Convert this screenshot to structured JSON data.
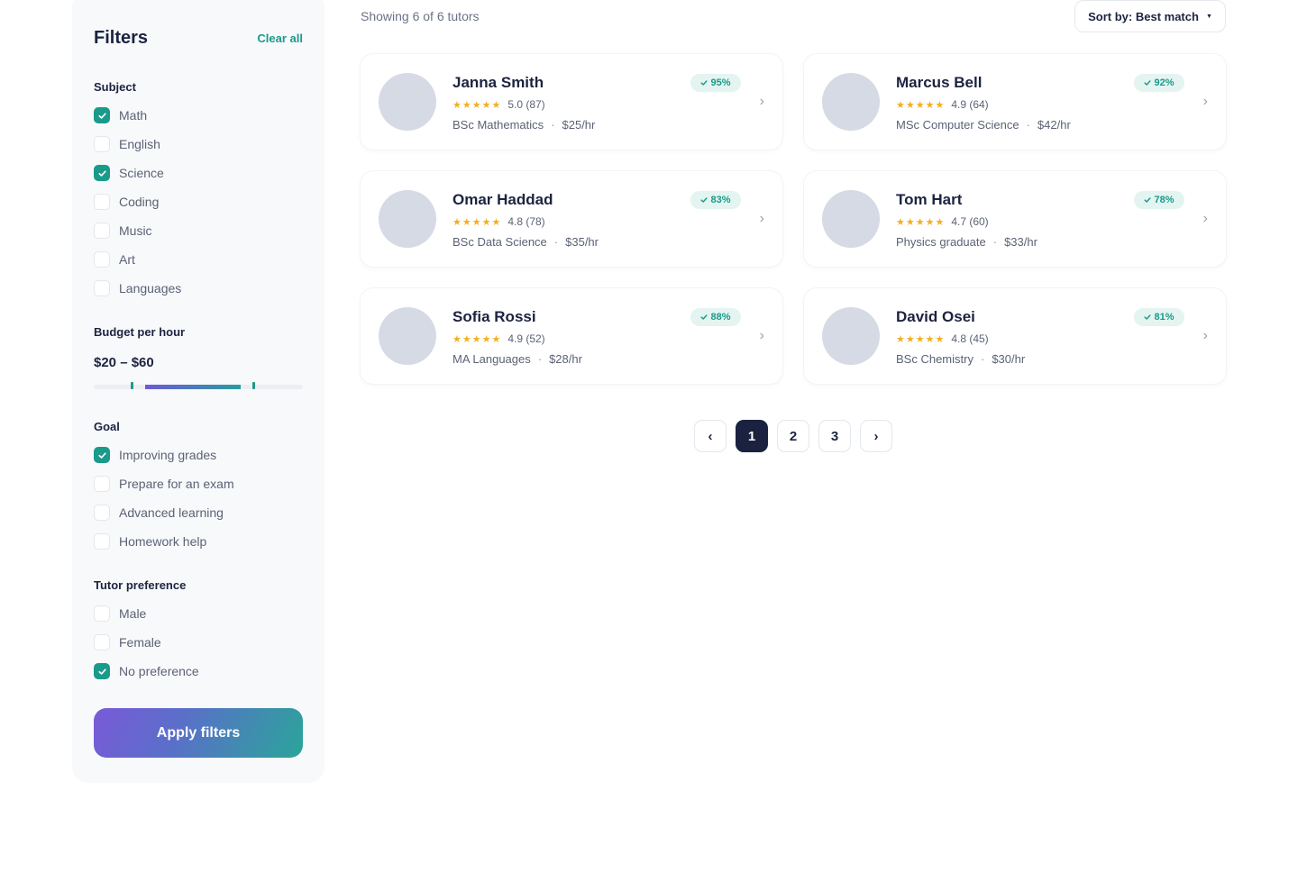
{
  "filters": {
    "title": "Filters",
    "clear_all": "Clear all",
    "subject": {
      "title": "Subject",
      "options": [
        {
          "label": "Math",
          "checked": true
        },
        {
          "label": "English",
          "checked": false
        },
        {
          "label": "Science",
          "checked": true
        },
        {
          "label": "Coding",
          "checked": false
        },
        {
          "label": "Music",
          "checked": false
        },
        {
          "label": "Art",
          "checked": false
        },
        {
          "label": "Languages",
          "checked": false
        }
      ]
    },
    "budget": {
      "title": "Budget per hour",
      "value": "$20 – $60",
      "min": 20,
      "max": 60
    },
    "goal": {
      "title": "Goal",
      "options": [
        {
          "label": "Improving grades",
          "checked": true
        },
        {
          "label": "Prepare for an exam",
          "checked": false
        },
        {
          "label": "Advanced learning",
          "checked": false
        },
        {
          "label": "Homework help",
          "checked": false
        }
      ]
    },
    "preference": {
      "title": "Tutor preference",
      "options": [
        {
          "label": "Male",
          "checked": false
        },
        {
          "label": "Female",
          "checked": false
        },
        {
          "label": "No preference",
          "checked": true
        }
      ]
    },
    "apply_label": "Apply filters"
  },
  "results": {
    "count_text": "Showing 6 of 6 tutors",
    "sort_label": "Sort by: Best match"
  },
  "tutors": [
    {
      "name": "Janna Smith",
      "stars": "★★★★★",
      "rating": "5.0 (87)",
      "degree": "BSc Mathematics",
      "rate": "$25/hr",
      "match": "95%"
    },
    {
      "name": "Marcus Bell",
      "stars": "★★★★★",
      "rating": "4.9 (64)",
      "degree": "MSc Computer Science",
      "rate": "$42/hr",
      "match": "92%"
    },
    {
      "name": "Omar Haddad",
      "stars": "★★★★★",
      "rating": "4.8 (78)",
      "degree": "BSc Data Science",
      "rate": "$35/hr",
      "match": "83%"
    },
    {
      "name": "Tom Hart",
      "stars": "★★★★★",
      "rating": "4.7 (60)",
      "degree": "Physics graduate",
      "rate": "$33/hr",
      "match": "78%"
    },
    {
      "name": "Sofia Rossi",
      "stars": "★★★★★",
      "rating": "4.9 (52)",
      "degree": "MA Languages",
      "rate": "$28/hr",
      "match": "88%"
    },
    {
      "name": "David Osei",
      "stars": "★★★★★",
      "rating": "4.8 (45)",
      "degree": "BSc Chemistry",
      "rate": "$30/hr",
      "match": "81%"
    }
  ],
  "icons": {
    "check": "check-icon",
    "chevron_right": "›",
    "chevron_left": "‹",
    "caret_down": "▼"
  },
  "pagination": {
    "prev": "‹",
    "pages": [
      "1",
      "2",
      "3"
    ],
    "current": "1",
    "next": "›"
  },
  "colors": {
    "accent": "#1a9a8a",
    "navy": "#1a2240",
    "star": "#f2b01e"
  }
}
